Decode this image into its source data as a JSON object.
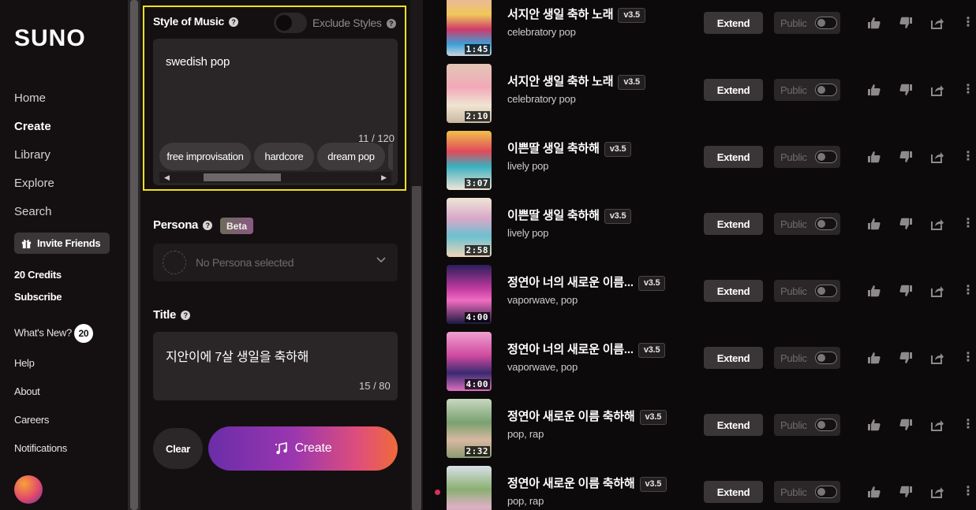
{
  "sidebar": {
    "logo": "SUNO",
    "nav": [
      "Home",
      "Create",
      "Library",
      "Explore",
      "Search"
    ],
    "invite_label": "Invite Friends",
    "credits": "20 Credits",
    "subscribe": "Subscribe",
    "whats_new": "What's New?",
    "whats_new_count": "20",
    "links": [
      "Help",
      "About",
      "Careers",
      "Notifications"
    ]
  },
  "create_panel": {
    "style_label": "Style of Music",
    "exclude_label": "Exclude Styles",
    "style_value": "swedish pop",
    "style_count": "11 / 120",
    "chips": [
      "free improvisation",
      "hardcore",
      "dream pop"
    ],
    "persona_label": "Persona",
    "persona_badge": "Beta",
    "persona_placeholder": "No Persona selected",
    "title_label": "Title",
    "title_value": "지안이에 7살 생일을 축하해",
    "title_count": "15 / 80",
    "clear_label": "Clear",
    "create_label": "Create"
  },
  "songs": [
    {
      "title": "서지안 생일 축하 노래",
      "version": "v3.5",
      "style": "celebratory pop",
      "duration": "1:45"
    },
    {
      "title": "서지안 생일 축하 노래",
      "version": "v3.5",
      "style": "celebratory pop",
      "duration": "2:10"
    },
    {
      "title": "이쁜딸 생일 축하해",
      "version": "v3.5",
      "style": "lively pop",
      "duration": "3:07"
    },
    {
      "title": "이쁜딸 생일 축하해",
      "version": "v3.5",
      "style": "lively pop",
      "duration": "2:58"
    },
    {
      "title": "정연아 너의 새로운 이름...",
      "version": "v3.5",
      "style": "vaporwave, pop",
      "duration": "4:00"
    },
    {
      "title": "정연아 너의 새로운 이름...",
      "version": "v3.5",
      "style": "vaporwave, pop",
      "duration": "4:00"
    },
    {
      "title": "정연아 새로운 이름 축하해",
      "version": "v3.5",
      "style": "pop, rap",
      "duration": "2:32"
    },
    {
      "title": "정연아 새로운 이름 축하해",
      "version": "v3.5",
      "style": "pop, rap",
      "duration": ""
    }
  ],
  "song_actions": {
    "extend_label": "Extend",
    "public_label": "Public"
  },
  "colors": {
    "highlight": "#f0e21a",
    "create_gradient_start": "#6a2da8",
    "create_gradient_end": "#f06a3a"
  }
}
